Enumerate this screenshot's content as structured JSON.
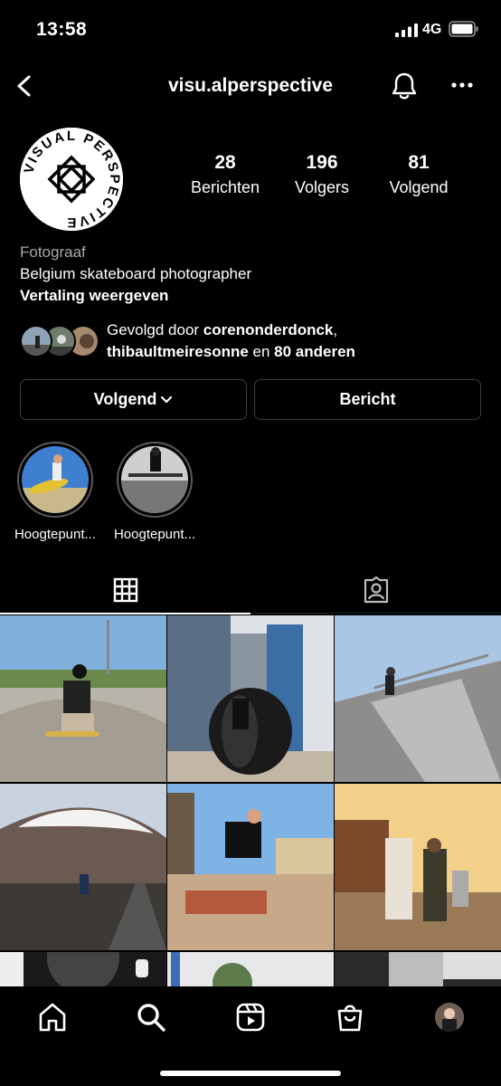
{
  "status_bar": {
    "time": "13:58",
    "network": "4G"
  },
  "header": {
    "username": "visu.alperspective"
  },
  "profile": {
    "logo_text": "VISUAL PERSPECTIVE",
    "stats": [
      {
        "value": "28",
        "label": "Berichten"
      },
      {
        "value": "196",
        "label": "Volgers"
      },
      {
        "value": "81",
        "label": "Volgend"
      }
    ],
    "category": "Fotograaf",
    "description": "Belgium skateboard photographer",
    "translate_label": "Vertaling weergeven",
    "followed_by": {
      "prefix": "Gevolgd door ",
      "user1": "corenonderdonck",
      "comma": ",",
      "user2": "thibaultmeiresonne",
      "middle": " en ",
      "others": "80 anderen"
    }
  },
  "actions": {
    "following_label": "Volgend",
    "message_label": "Bericht"
  },
  "highlights": [
    {
      "label": "Hoogtepunt..."
    },
    {
      "label": "Hoogtepunt..."
    }
  ],
  "tabs": [
    {
      "icon": "grid-icon",
      "active": true
    },
    {
      "icon": "tagged-icon",
      "active": false
    }
  ],
  "nav": [
    "home-icon",
    "search-icon",
    "reels-icon",
    "shop-icon",
    "profile-avatar"
  ]
}
